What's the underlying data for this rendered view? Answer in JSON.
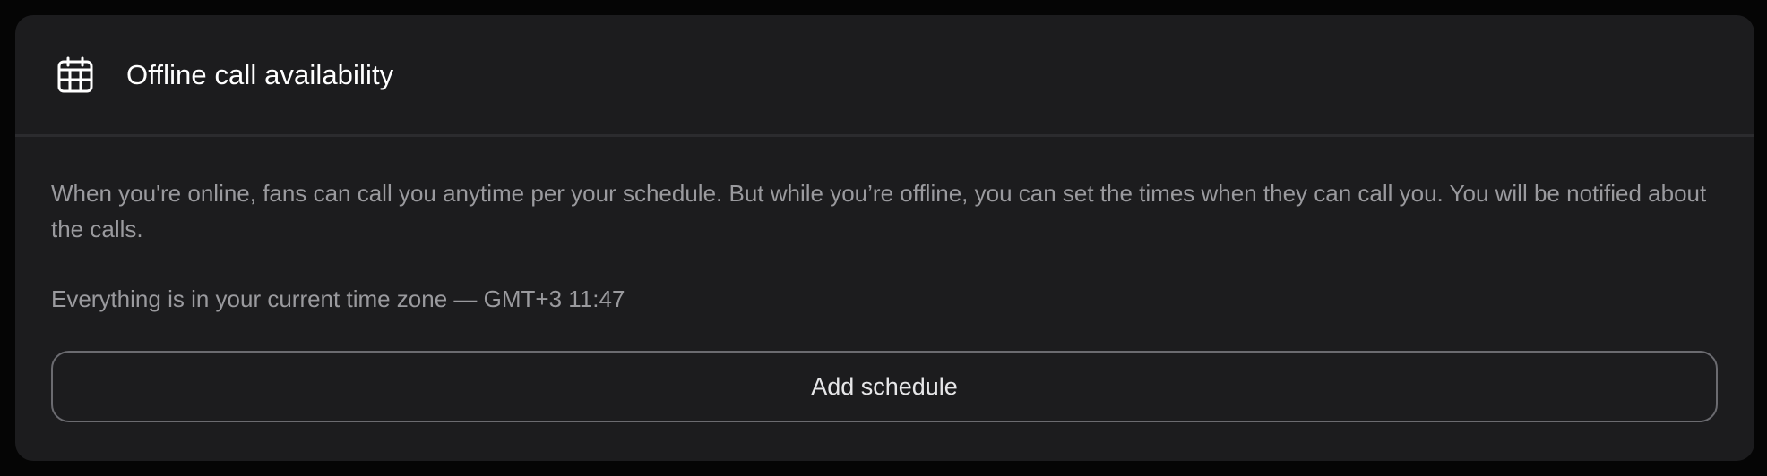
{
  "card": {
    "icon": "calendar-icon",
    "title": "Offline call availability",
    "description": "When you're online, fans can call you anytime per your schedule. But while you’re offline, you can set the times when they can call you. You will be notified about the calls.",
    "timezone_note": "Everything is in your current time zone — GMT+3 11:47",
    "add_button_label": "Add schedule"
  },
  "colors": {
    "background": "#050505",
    "card": "#1c1c1e",
    "title_text": "#ffffff",
    "body_text": "#9a9a9e",
    "button_border": "#6b6b70"
  }
}
